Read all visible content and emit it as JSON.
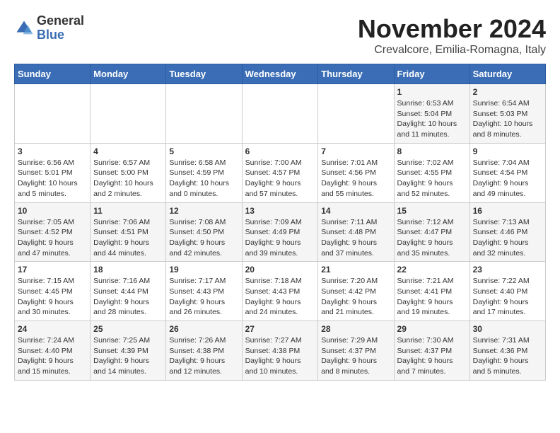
{
  "logo": {
    "general": "General",
    "blue": "Blue"
  },
  "title": "November 2024",
  "location": "Crevalcore, Emilia-Romagna, Italy",
  "days_header": [
    "Sunday",
    "Monday",
    "Tuesday",
    "Wednesday",
    "Thursday",
    "Friday",
    "Saturday"
  ],
  "weeks": [
    [
      {
        "day": "",
        "sunrise": "",
        "sunset": "",
        "daylight": ""
      },
      {
        "day": "",
        "sunrise": "",
        "sunset": "",
        "daylight": ""
      },
      {
        "day": "",
        "sunrise": "",
        "sunset": "",
        "daylight": ""
      },
      {
        "day": "",
        "sunrise": "",
        "sunset": "",
        "daylight": ""
      },
      {
        "day": "",
        "sunrise": "",
        "sunset": "",
        "daylight": ""
      },
      {
        "day": "1",
        "sunrise": "Sunrise: 6:53 AM",
        "sunset": "Sunset: 5:04 PM",
        "daylight": "Daylight: 10 hours and 11 minutes."
      },
      {
        "day": "2",
        "sunrise": "Sunrise: 6:54 AM",
        "sunset": "Sunset: 5:03 PM",
        "daylight": "Daylight: 10 hours and 8 minutes."
      }
    ],
    [
      {
        "day": "3",
        "sunrise": "Sunrise: 6:56 AM",
        "sunset": "Sunset: 5:01 PM",
        "daylight": "Daylight: 10 hours and 5 minutes."
      },
      {
        "day": "4",
        "sunrise": "Sunrise: 6:57 AM",
        "sunset": "Sunset: 5:00 PM",
        "daylight": "Daylight: 10 hours and 2 minutes."
      },
      {
        "day": "5",
        "sunrise": "Sunrise: 6:58 AM",
        "sunset": "Sunset: 4:59 PM",
        "daylight": "Daylight: 10 hours and 0 minutes."
      },
      {
        "day": "6",
        "sunrise": "Sunrise: 7:00 AM",
        "sunset": "Sunset: 4:57 PM",
        "daylight": "Daylight: 9 hours and 57 minutes."
      },
      {
        "day": "7",
        "sunrise": "Sunrise: 7:01 AM",
        "sunset": "Sunset: 4:56 PM",
        "daylight": "Daylight: 9 hours and 55 minutes."
      },
      {
        "day": "8",
        "sunrise": "Sunrise: 7:02 AM",
        "sunset": "Sunset: 4:55 PM",
        "daylight": "Daylight: 9 hours and 52 minutes."
      },
      {
        "day": "9",
        "sunrise": "Sunrise: 7:04 AM",
        "sunset": "Sunset: 4:54 PM",
        "daylight": "Daylight: 9 hours and 49 minutes."
      }
    ],
    [
      {
        "day": "10",
        "sunrise": "Sunrise: 7:05 AM",
        "sunset": "Sunset: 4:52 PM",
        "daylight": "Daylight: 9 hours and 47 minutes."
      },
      {
        "day": "11",
        "sunrise": "Sunrise: 7:06 AM",
        "sunset": "Sunset: 4:51 PM",
        "daylight": "Daylight: 9 hours and 44 minutes."
      },
      {
        "day": "12",
        "sunrise": "Sunrise: 7:08 AM",
        "sunset": "Sunset: 4:50 PM",
        "daylight": "Daylight: 9 hours and 42 minutes."
      },
      {
        "day": "13",
        "sunrise": "Sunrise: 7:09 AM",
        "sunset": "Sunset: 4:49 PM",
        "daylight": "Daylight: 9 hours and 39 minutes."
      },
      {
        "day": "14",
        "sunrise": "Sunrise: 7:11 AM",
        "sunset": "Sunset: 4:48 PM",
        "daylight": "Daylight: 9 hours and 37 minutes."
      },
      {
        "day": "15",
        "sunrise": "Sunrise: 7:12 AM",
        "sunset": "Sunset: 4:47 PM",
        "daylight": "Daylight: 9 hours and 35 minutes."
      },
      {
        "day": "16",
        "sunrise": "Sunrise: 7:13 AM",
        "sunset": "Sunset: 4:46 PM",
        "daylight": "Daylight: 9 hours and 32 minutes."
      }
    ],
    [
      {
        "day": "17",
        "sunrise": "Sunrise: 7:15 AM",
        "sunset": "Sunset: 4:45 PM",
        "daylight": "Daylight: 9 hours and 30 minutes."
      },
      {
        "day": "18",
        "sunrise": "Sunrise: 7:16 AM",
        "sunset": "Sunset: 4:44 PM",
        "daylight": "Daylight: 9 hours and 28 minutes."
      },
      {
        "day": "19",
        "sunrise": "Sunrise: 7:17 AM",
        "sunset": "Sunset: 4:43 PM",
        "daylight": "Daylight: 9 hours and 26 minutes."
      },
      {
        "day": "20",
        "sunrise": "Sunrise: 7:18 AM",
        "sunset": "Sunset: 4:43 PM",
        "daylight": "Daylight: 9 hours and 24 minutes."
      },
      {
        "day": "21",
        "sunrise": "Sunrise: 7:20 AM",
        "sunset": "Sunset: 4:42 PM",
        "daylight": "Daylight: 9 hours and 21 minutes."
      },
      {
        "day": "22",
        "sunrise": "Sunrise: 7:21 AM",
        "sunset": "Sunset: 4:41 PM",
        "daylight": "Daylight: 9 hours and 19 minutes."
      },
      {
        "day": "23",
        "sunrise": "Sunrise: 7:22 AM",
        "sunset": "Sunset: 4:40 PM",
        "daylight": "Daylight: 9 hours and 17 minutes."
      }
    ],
    [
      {
        "day": "24",
        "sunrise": "Sunrise: 7:24 AM",
        "sunset": "Sunset: 4:40 PM",
        "daylight": "Daylight: 9 hours and 15 minutes."
      },
      {
        "day": "25",
        "sunrise": "Sunrise: 7:25 AM",
        "sunset": "Sunset: 4:39 PM",
        "daylight": "Daylight: 9 hours and 14 minutes."
      },
      {
        "day": "26",
        "sunrise": "Sunrise: 7:26 AM",
        "sunset": "Sunset: 4:38 PM",
        "daylight": "Daylight: 9 hours and 12 minutes."
      },
      {
        "day": "27",
        "sunrise": "Sunrise: 7:27 AM",
        "sunset": "Sunset: 4:38 PM",
        "daylight": "Daylight: 9 hours and 10 minutes."
      },
      {
        "day": "28",
        "sunrise": "Sunrise: 7:29 AM",
        "sunset": "Sunset: 4:37 PM",
        "daylight": "Daylight: 9 hours and 8 minutes."
      },
      {
        "day": "29",
        "sunrise": "Sunrise: 7:30 AM",
        "sunset": "Sunset: 4:37 PM",
        "daylight": "Daylight: 9 hours and 7 minutes."
      },
      {
        "day": "30",
        "sunrise": "Sunrise: 7:31 AM",
        "sunset": "Sunset: 4:36 PM",
        "daylight": "Daylight: 9 hours and 5 minutes."
      }
    ]
  ]
}
